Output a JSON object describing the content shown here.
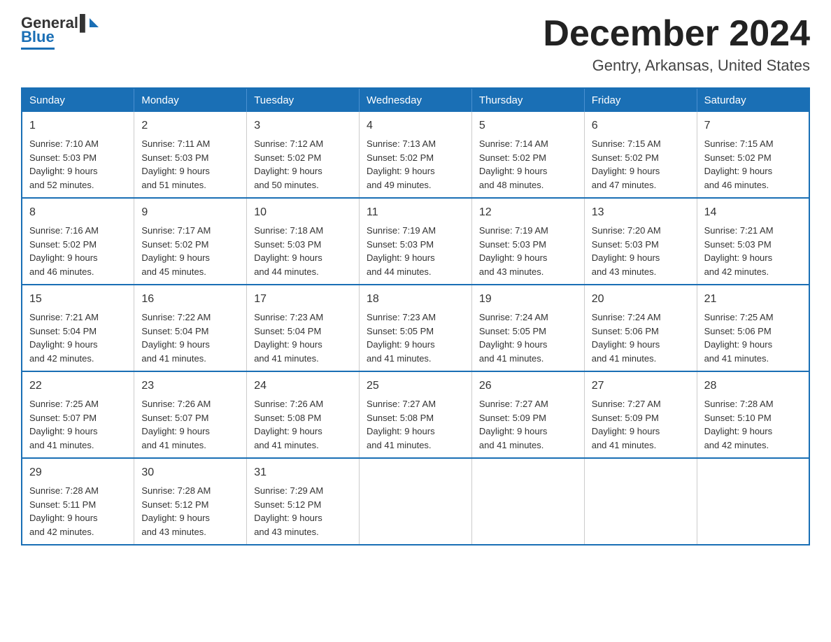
{
  "logo": {
    "general": "General",
    "blue": "Blue"
  },
  "title": {
    "month_year": "December 2024",
    "location": "Gentry, Arkansas, United States"
  },
  "weekdays": [
    "Sunday",
    "Monday",
    "Tuesday",
    "Wednesday",
    "Thursday",
    "Friday",
    "Saturday"
  ],
  "weeks": [
    [
      {
        "day": "1",
        "sunrise": "7:10 AM",
        "sunset": "5:03 PM",
        "daylight": "9 hours and 52 minutes."
      },
      {
        "day": "2",
        "sunrise": "7:11 AM",
        "sunset": "5:03 PM",
        "daylight": "9 hours and 51 minutes."
      },
      {
        "day": "3",
        "sunrise": "7:12 AM",
        "sunset": "5:02 PM",
        "daylight": "9 hours and 50 minutes."
      },
      {
        "day": "4",
        "sunrise": "7:13 AM",
        "sunset": "5:02 PM",
        "daylight": "9 hours and 49 minutes."
      },
      {
        "day": "5",
        "sunrise": "7:14 AM",
        "sunset": "5:02 PM",
        "daylight": "9 hours and 48 minutes."
      },
      {
        "day": "6",
        "sunrise": "7:15 AM",
        "sunset": "5:02 PM",
        "daylight": "9 hours and 47 minutes."
      },
      {
        "day": "7",
        "sunrise": "7:15 AM",
        "sunset": "5:02 PM",
        "daylight": "9 hours and 46 minutes."
      }
    ],
    [
      {
        "day": "8",
        "sunrise": "7:16 AM",
        "sunset": "5:02 PM",
        "daylight": "9 hours and 46 minutes."
      },
      {
        "day": "9",
        "sunrise": "7:17 AM",
        "sunset": "5:02 PM",
        "daylight": "9 hours and 45 minutes."
      },
      {
        "day": "10",
        "sunrise": "7:18 AM",
        "sunset": "5:03 PM",
        "daylight": "9 hours and 44 minutes."
      },
      {
        "day": "11",
        "sunrise": "7:19 AM",
        "sunset": "5:03 PM",
        "daylight": "9 hours and 44 minutes."
      },
      {
        "day": "12",
        "sunrise": "7:19 AM",
        "sunset": "5:03 PM",
        "daylight": "9 hours and 43 minutes."
      },
      {
        "day": "13",
        "sunrise": "7:20 AM",
        "sunset": "5:03 PM",
        "daylight": "9 hours and 43 minutes."
      },
      {
        "day": "14",
        "sunrise": "7:21 AM",
        "sunset": "5:03 PM",
        "daylight": "9 hours and 42 minutes."
      }
    ],
    [
      {
        "day": "15",
        "sunrise": "7:21 AM",
        "sunset": "5:04 PM",
        "daylight": "9 hours and 42 minutes."
      },
      {
        "day": "16",
        "sunrise": "7:22 AM",
        "sunset": "5:04 PM",
        "daylight": "9 hours and 41 minutes."
      },
      {
        "day": "17",
        "sunrise": "7:23 AM",
        "sunset": "5:04 PM",
        "daylight": "9 hours and 41 minutes."
      },
      {
        "day": "18",
        "sunrise": "7:23 AM",
        "sunset": "5:05 PM",
        "daylight": "9 hours and 41 minutes."
      },
      {
        "day": "19",
        "sunrise": "7:24 AM",
        "sunset": "5:05 PM",
        "daylight": "9 hours and 41 minutes."
      },
      {
        "day": "20",
        "sunrise": "7:24 AM",
        "sunset": "5:06 PM",
        "daylight": "9 hours and 41 minutes."
      },
      {
        "day": "21",
        "sunrise": "7:25 AM",
        "sunset": "5:06 PM",
        "daylight": "9 hours and 41 minutes."
      }
    ],
    [
      {
        "day": "22",
        "sunrise": "7:25 AM",
        "sunset": "5:07 PM",
        "daylight": "9 hours and 41 minutes."
      },
      {
        "day": "23",
        "sunrise": "7:26 AM",
        "sunset": "5:07 PM",
        "daylight": "9 hours and 41 minutes."
      },
      {
        "day": "24",
        "sunrise": "7:26 AM",
        "sunset": "5:08 PM",
        "daylight": "9 hours and 41 minutes."
      },
      {
        "day": "25",
        "sunrise": "7:27 AM",
        "sunset": "5:08 PM",
        "daylight": "9 hours and 41 minutes."
      },
      {
        "day": "26",
        "sunrise": "7:27 AM",
        "sunset": "5:09 PM",
        "daylight": "9 hours and 41 minutes."
      },
      {
        "day": "27",
        "sunrise": "7:27 AM",
        "sunset": "5:09 PM",
        "daylight": "9 hours and 41 minutes."
      },
      {
        "day": "28",
        "sunrise": "7:28 AM",
        "sunset": "5:10 PM",
        "daylight": "9 hours and 42 minutes."
      }
    ],
    [
      {
        "day": "29",
        "sunrise": "7:28 AM",
        "sunset": "5:11 PM",
        "daylight": "9 hours and 42 minutes."
      },
      {
        "day": "30",
        "sunrise": "7:28 AM",
        "sunset": "5:12 PM",
        "daylight": "9 hours and 43 minutes."
      },
      {
        "day": "31",
        "sunrise": "7:29 AM",
        "sunset": "5:12 PM",
        "daylight": "9 hours and 43 minutes."
      },
      null,
      null,
      null,
      null
    ]
  ],
  "labels": {
    "sunrise": "Sunrise: ",
    "sunset": "Sunset: ",
    "daylight": "Daylight: "
  }
}
